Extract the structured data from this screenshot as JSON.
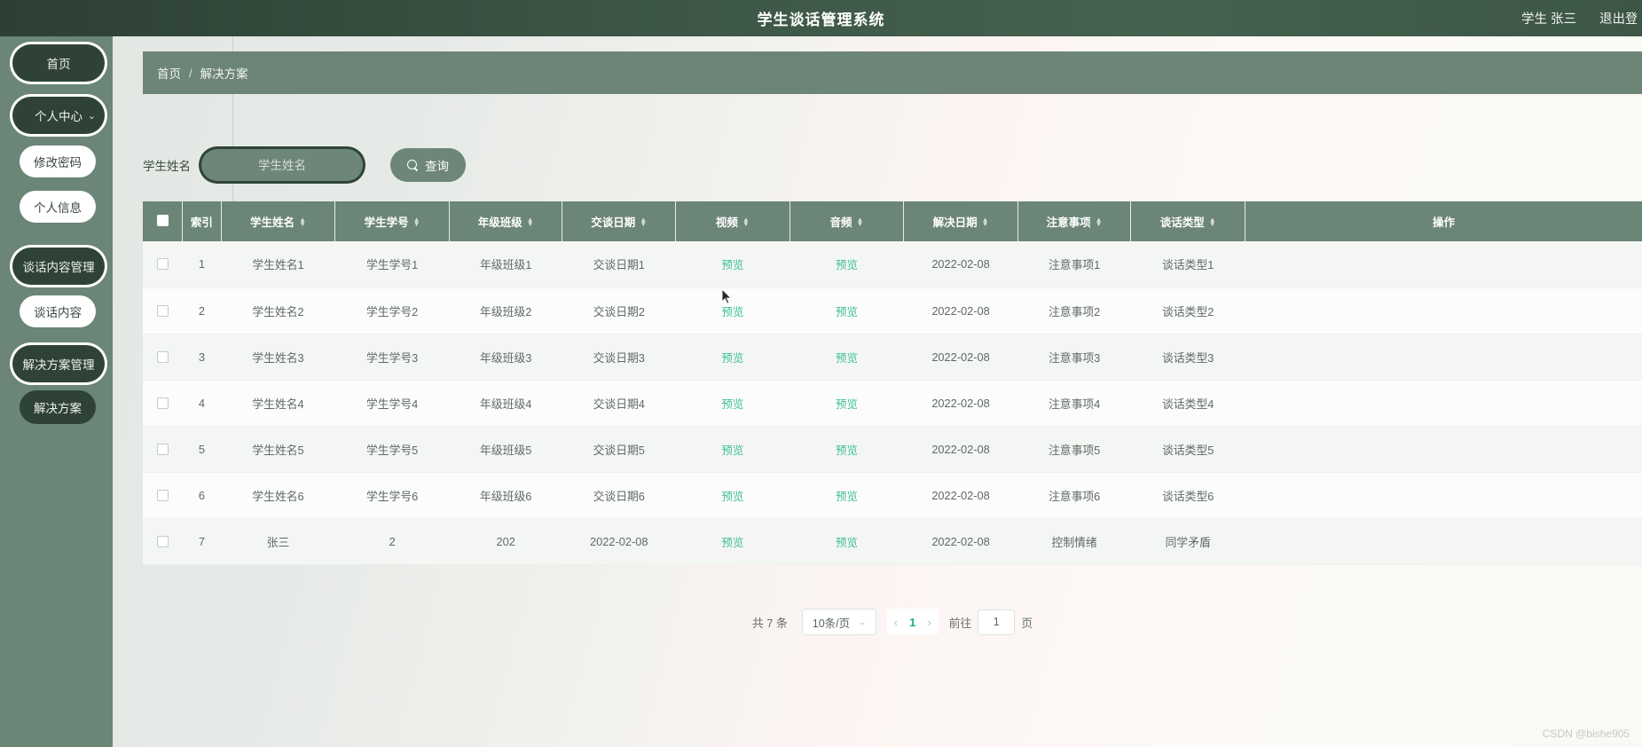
{
  "header": {
    "title": "学生谈话管理系统",
    "user_label": "学生 张三",
    "logout_label": "退出登录"
  },
  "sidebar": {
    "items": [
      {
        "label": "首页",
        "style": "dark",
        "caret": ""
      },
      {
        "label": "个人中心",
        "style": "dark",
        "caret": "⌄"
      },
      {
        "label": "修改密码",
        "style": "light",
        "caret": ""
      },
      {
        "label": "个人信息",
        "style": "light",
        "caret": ""
      },
      {
        "label": "谈话内容管理",
        "style": "dark",
        "caret": "⌄"
      },
      {
        "label": "谈话内容",
        "style": "light",
        "caret": ""
      },
      {
        "label": "解决方案管理",
        "style": "dark",
        "caret": "⌄"
      },
      {
        "label": "解决方案",
        "style": "dark",
        "caret": ""
      }
    ]
  },
  "breadcrumb": {
    "home": "首页",
    "separator": "/",
    "current": "解决方案"
  },
  "search": {
    "label": "学生姓名",
    "placeholder": "学生姓名",
    "value": "",
    "button_label": "查询",
    "button_icon": "search-icon"
  },
  "table": {
    "columns": [
      {
        "key": "checkbox",
        "label": "",
        "sortable": false
      },
      {
        "key": "index",
        "label": "索引",
        "sortable": false
      },
      {
        "key": "student_name",
        "label": "学生姓名",
        "sortable": true
      },
      {
        "key": "student_id",
        "label": "学生学号",
        "sortable": true
      },
      {
        "key": "grade_class",
        "label": "年级班级",
        "sortable": true
      },
      {
        "key": "talk_date",
        "label": "交谈日期",
        "sortable": true
      },
      {
        "key": "video",
        "label": "视频",
        "sortable": true
      },
      {
        "key": "audio",
        "label": "音频",
        "sortable": true
      },
      {
        "key": "solve_date",
        "label": "解决日期",
        "sortable": true
      },
      {
        "key": "notes",
        "label": "注意事项",
        "sortable": true
      },
      {
        "key": "talk_type",
        "label": "谈话类型",
        "sortable": true
      },
      {
        "key": "actions",
        "label": "操作",
        "sortable": false
      }
    ],
    "preview_label": "预览",
    "rows": [
      {
        "index": "1",
        "student_name": "学生姓名1",
        "student_id": "学生学号1",
        "grade_class": "年级班级1",
        "talk_date": "交谈日期1",
        "video": "预览",
        "audio": "预览",
        "solve_date": "2022-02-08",
        "notes": "注意事项1",
        "talk_type": "谈话类型1",
        "actions": ""
      },
      {
        "index": "2",
        "student_name": "学生姓名2",
        "student_id": "学生学号2",
        "grade_class": "年级班级2",
        "talk_date": "交谈日期2",
        "video": "预览",
        "audio": "预览",
        "solve_date": "2022-02-08",
        "notes": "注意事项2",
        "talk_type": "谈话类型2",
        "actions": ""
      },
      {
        "index": "3",
        "student_name": "学生姓名3",
        "student_id": "学生学号3",
        "grade_class": "年级班级3",
        "talk_date": "交谈日期3",
        "video": "预览",
        "audio": "预览",
        "solve_date": "2022-02-08",
        "notes": "注意事项3",
        "talk_type": "谈话类型3",
        "actions": ""
      },
      {
        "index": "4",
        "student_name": "学生姓名4",
        "student_id": "学生学号4",
        "grade_class": "年级班级4",
        "talk_date": "交谈日期4",
        "video": "预览",
        "audio": "预览",
        "solve_date": "2022-02-08",
        "notes": "注意事项4",
        "talk_type": "谈话类型4",
        "actions": ""
      },
      {
        "index": "5",
        "student_name": "学生姓名5",
        "student_id": "学生学号5",
        "grade_class": "年级班级5",
        "talk_date": "交谈日期5",
        "video": "预览",
        "audio": "预览",
        "solve_date": "2022-02-08",
        "notes": "注意事项5",
        "talk_type": "谈话类型5",
        "actions": ""
      },
      {
        "index": "6",
        "student_name": "学生姓名6",
        "student_id": "学生学号6",
        "grade_class": "年级班级6",
        "talk_date": "交谈日期6",
        "video": "预览",
        "audio": "预览",
        "solve_date": "2022-02-08",
        "notes": "注意事项6",
        "talk_type": "谈话类型6",
        "actions": ""
      },
      {
        "index": "7",
        "student_name": "张三",
        "student_id": "2",
        "grade_class": "202",
        "talk_date": "2022-02-08",
        "video": "预览",
        "audio": "预览",
        "solve_date": "2022-02-08",
        "notes": "控制情绪",
        "talk_type": "同学矛盾",
        "actions": ""
      }
    ]
  },
  "pagination": {
    "total_text": "共 7 条",
    "page_size_label": "10条/页",
    "prev_icon": "‹",
    "next_icon": "›",
    "current_page": "1",
    "jump_prefix": "前往",
    "jump_value": "1",
    "jump_suffix": "页"
  },
  "watermark": "CSDN @bishe905",
  "colors": {
    "header_dark": "#2c4033",
    "sidebar_green": "#6b8576",
    "table_header": "#6b8577",
    "preview_link": "#3fbf92",
    "page_active": "#1bb57f"
  }
}
